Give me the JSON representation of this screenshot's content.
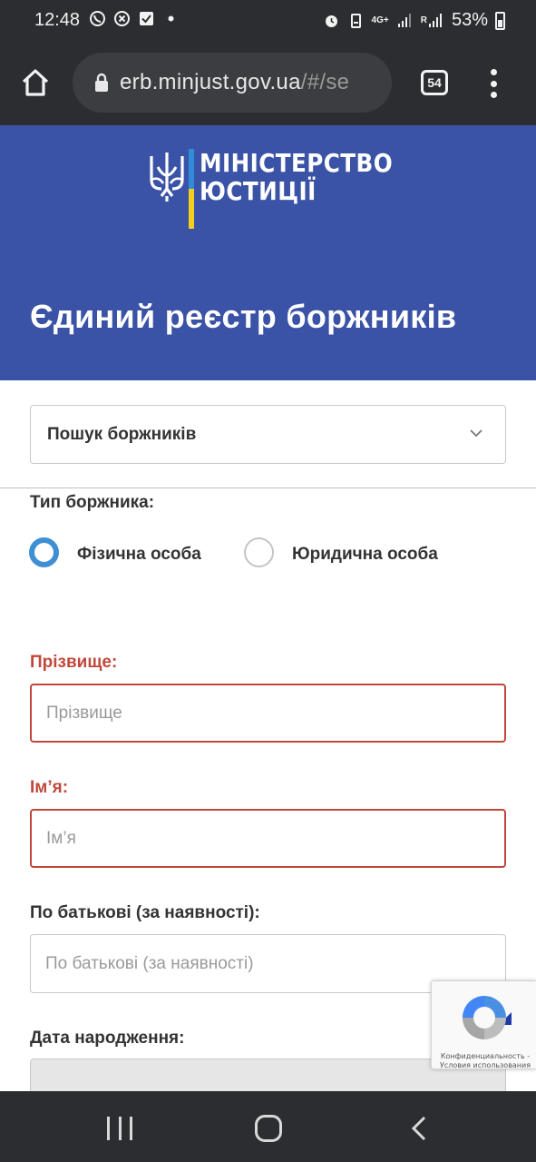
{
  "status_bar": {
    "time": "12:48",
    "network": "4G+",
    "roaming": "R",
    "battery": "53%",
    "left_icons": [
      "viber-icon",
      "close-circle-icon",
      "check-box-icon",
      "dot-icon"
    ],
    "right_icons": [
      "alarm-icon",
      "battery-saver-icon",
      "signal-icon",
      "signal-icon",
      "battery-icon"
    ]
  },
  "browser": {
    "url_host": "erb.minjust.gov.ua",
    "url_path": "/#/se",
    "tab_count": "54"
  },
  "header": {
    "logo_line1": "МІНІСТЕРСТВО",
    "logo_line2": "ЮСТИЦІЇ",
    "title": "Єдиний реєстр боржників",
    "colors": {
      "background": "#3b53a6",
      "flag_blue": "#2e8cd8",
      "flag_yellow": "#f2cf1c"
    }
  },
  "search_type": {
    "selected": "Пошук боржників"
  },
  "form": {
    "debtor_type_label": "Тип боржника:",
    "radio_individual": "Фізична особа",
    "radio_legal": "Юридична особа",
    "selected_radio": "individual",
    "surname_label": "Прізвище:",
    "surname_placeholder": "Прізвище",
    "name_label": "Ім’я:",
    "name_placeholder": "Ім’я",
    "patronymic_label": "По батькові (за наявності):",
    "patronymic_placeholder": "По батькові (за наявності)",
    "birthdate_label": "Дата народження:",
    "required_color": "#c0483b"
  },
  "recaptcha": {
    "text": "Конфиденциальность - Условия использования"
  }
}
